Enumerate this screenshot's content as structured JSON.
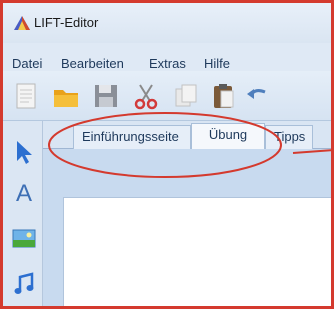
{
  "window": {
    "title": "LIFT-Editor"
  },
  "menu": {
    "items": [
      "Datei",
      "Bearbeiten",
      "Extras",
      "Hilfe"
    ]
  },
  "toolbar": {
    "tools": [
      {
        "name": "new-document-icon"
      },
      {
        "name": "open-folder-icon"
      },
      {
        "name": "save-icon"
      },
      {
        "name": "cut-icon"
      },
      {
        "name": "copy-icon"
      },
      {
        "name": "paste-icon"
      },
      {
        "name": "undo-icon"
      }
    ]
  },
  "sidebar": {
    "tools": [
      {
        "name": "pointer-tool-icon"
      },
      {
        "name": "text-tool-icon",
        "glyph": "A"
      },
      {
        "name": "image-tool-icon"
      },
      {
        "name": "audio-tool-icon"
      }
    ]
  },
  "tabs": {
    "items": [
      "Einführungsseite",
      "Übung",
      "Tipps"
    ],
    "active_index": 1
  },
  "colors": {
    "highlight": "#d43a2e",
    "accent": "#2c6fd0"
  }
}
